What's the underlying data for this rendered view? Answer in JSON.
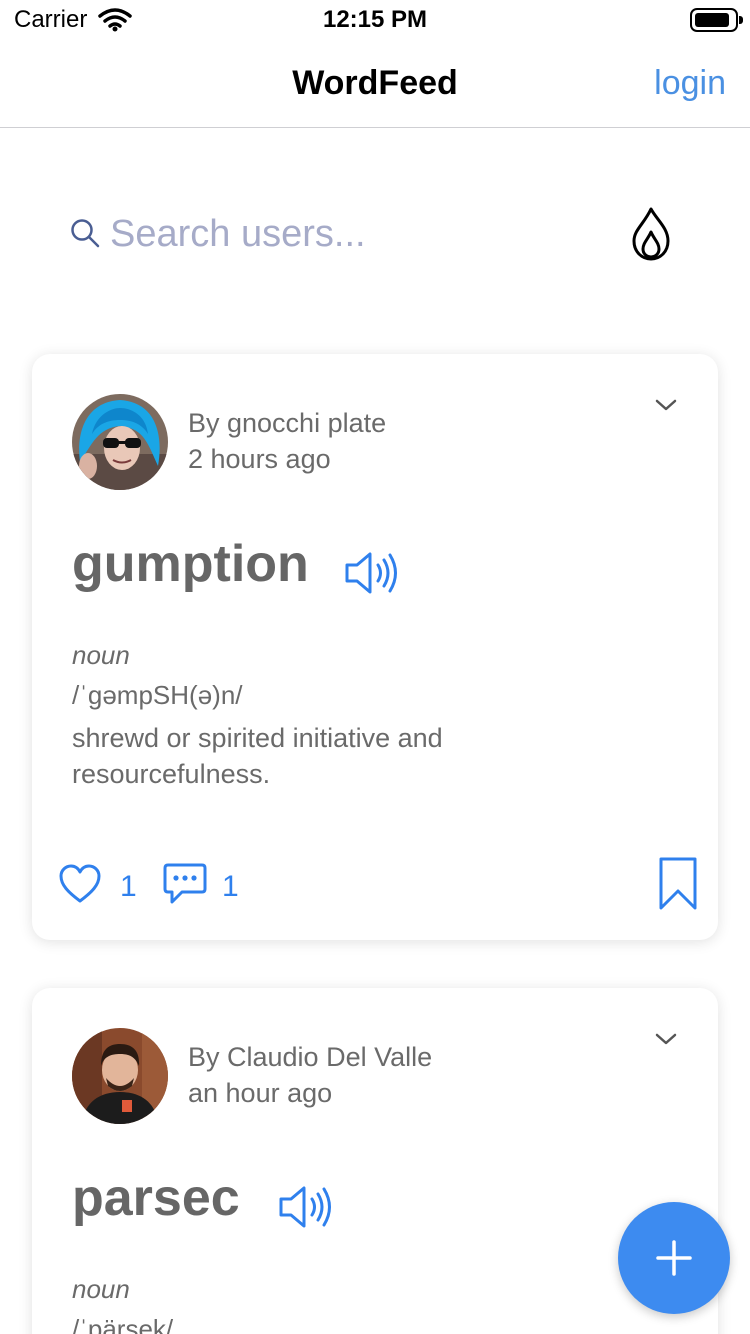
{
  "status_bar": {
    "carrier": "Carrier",
    "time": "12:15 PM"
  },
  "nav": {
    "title": "WordFeed",
    "login_label": "login"
  },
  "search": {
    "placeholder": "Search users..."
  },
  "posts": [
    {
      "author": "By gnocchi plate",
      "time": "2 hours ago",
      "word": "gumption",
      "part_of_speech": "noun",
      "phonetic": "/ˈgəmpSH(ə)n/",
      "definition": "shrewd or spirited initiative and resourcefulness.",
      "likes": "1",
      "comments": "1"
    },
    {
      "author": "By Claudio Del Valle",
      "time": "an hour ago",
      "word": "parsec",
      "part_of_speech": "noun",
      "phonetic": "/ˈpärsek/"
    }
  ],
  "icons": {
    "signal": "wifi-icon",
    "battery": "battery-icon",
    "search": "search-icon",
    "trending": "flame-icon",
    "options": "chevron-down-icon",
    "pronounce": "speaker-icon",
    "like": "heart-icon",
    "comment": "comment-icon",
    "save": "bookmark-icon",
    "add": "plus-icon"
  },
  "colors": {
    "accent": "#2f80ed",
    "fab": "#3d8bf0",
    "placeholder": "#a6abc8",
    "text_muted": "#6a6a6a"
  }
}
